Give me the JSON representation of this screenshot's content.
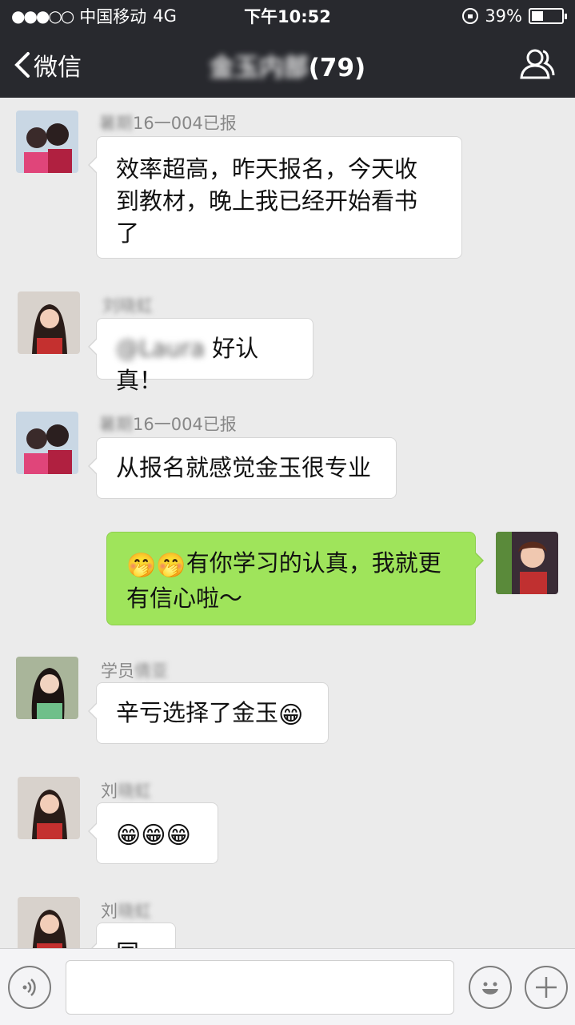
{
  "status_bar": {
    "carrier": "中国移动",
    "network": "4G",
    "time": "下午10:52",
    "battery": "39%",
    "battery_level": 0.39
  },
  "nav": {
    "back_label": "微信",
    "title_blurred": "金玉内部",
    "title_suffix": "(79)"
  },
  "messages": [
    {
      "sender_blurred": "暑期",
      "sender_tail": "16一004已报",
      "lines": [
        "效率超高，昨天报名，今天收",
        "到教材，晚上我已经开始看书",
        "了"
      ]
    },
    {
      "sender_blurred": "刘晓虹",
      "sender_tail": "",
      "text_blurred": "@Laura",
      "text": "好认真！"
    },
    {
      "sender_blurred": "暑期",
      "sender_tail": "16一004已报",
      "text": "从报名就感觉金玉很专业"
    },
    {
      "outgoing": true,
      "lines": [
        "有你学习的认真，我就更",
        "有信心啦～"
      ],
      "emojis": [
        "🤭",
        "🤭"
      ]
    },
    {
      "sender_visible": "学员",
      "sender_blurred": "倩亚",
      "text": "辛亏选择了金玉",
      "emoji": "😁"
    },
    {
      "sender_visible": "刘",
      "sender_blurred": "晓虹",
      "emojis": [
        "😁",
        "😁",
        "😁"
      ]
    },
    {
      "sender_visible": "刘",
      "sender_blurred": "晓虹",
      "text": "同感"
    }
  ],
  "input_bar": {
    "voice_icon": "voice-icon",
    "emoji_icon": "emoji-icon",
    "plus_icon": "plus-icon",
    "placeholder": ""
  },
  "colors": {
    "topbar": "#28292e",
    "chat_bg": "#ebebeb",
    "out_bubble": "#9fe45b"
  }
}
